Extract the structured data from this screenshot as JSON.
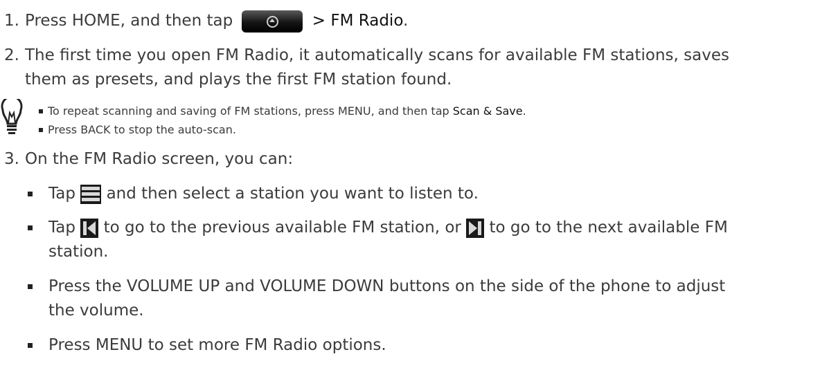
{
  "step1": {
    "number": "1.",
    "text_before": "Press HOME, and then tap",
    "text_after": "> FM Radio",
    "period": "."
  },
  "step2": {
    "number": "2.",
    "line1": "The first time you open FM Radio, it automatically scans for available FM stations, saves",
    "line2": "them as presets, and plays the first FM station found."
  },
  "tips": {
    "tip1_before": "To repeat scanning and saving of FM stations, press MENU, and then tap",
    "tip1_bold": "Scan & Save",
    "tip1_after": ".",
    "tip2": "Press BACK to stop the auto-scan."
  },
  "step3": {
    "number": "3.",
    "intro": "On the FM Radio screen, you can:",
    "b1_before": "Tap",
    "b1_after": "and then select a station you want to listen to.",
    "b2_tap": "Tap",
    "b2_mid": "to go to the previous available FM station, or",
    "b2_after": "to go to the next available FM",
    "b2_line2": "station.",
    "b3_line1": "Press the VOLUME UP and VOLUME DOWN buttons on the side of the phone to adjust",
    "b3_line2": "the volume.",
    "b4": "Press MENU to set more FM Radio options."
  },
  "icons": {
    "home_button": "launcher-button-icon",
    "tip": "lightbulb-icon",
    "list": "station-list-icon",
    "previous": "previous-station-icon",
    "next": "next-station-icon"
  }
}
